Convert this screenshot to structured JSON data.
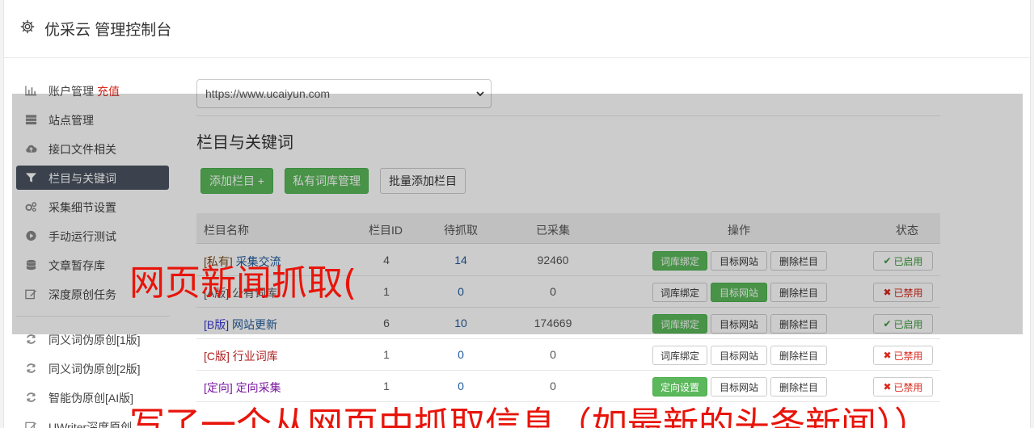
{
  "header": {
    "title": "优采云 管理控制台",
    "icon": "gear-icon"
  },
  "sidebar": {
    "items": [
      {
        "label": "账户管理",
        "extra": "充值",
        "icon": "bar-chart-icon"
      },
      {
        "label": "站点管理",
        "icon": "server-icon"
      },
      {
        "label": "接口文件相关",
        "icon": "cloud-upload-icon"
      },
      {
        "label": "栏目与关键词",
        "icon": "filter-icon",
        "active": true
      },
      {
        "label": "采集细节设置",
        "icon": "cogs-icon"
      },
      {
        "label": "手动运行测试",
        "icon": "play-circle-icon"
      },
      {
        "label": "文章暂存库",
        "icon": "database-icon"
      },
      {
        "label": "深度原创任务",
        "icon": "edit-icon"
      },
      {
        "label": "同义词伪原创[1版]",
        "icon": "refresh-icon"
      },
      {
        "label": "同义词伪原创[2版]",
        "icon": "refresh-icon"
      },
      {
        "label": "智能伪原创[AI版]",
        "icon": "refresh-icon"
      },
      {
        "label": "UWriter深度原创",
        "icon": "edit-icon"
      }
    ]
  },
  "site_select": {
    "value": "https://www.ucaiyun.com"
  },
  "section": {
    "title": "栏目与关键词"
  },
  "toolbar": {
    "add_column": "添加栏目 +",
    "private_lexicon": "私有词库管理",
    "batch_add": "批量添加栏目"
  },
  "table": {
    "headers": {
      "name": "栏目名称",
      "id": "栏目ID",
      "pending": "待抓取",
      "collected": "已采集",
      "ops": "操作",
      "status": "状态"
    },
    "rows": [
      {
        "tag": "[私有]",
        "name": "采集交流",
        "id": "4",
        "pending": "14",
        "collected": "92460",
        "op1": "词库绑定",
        "op2": "目标网站",
        "op3": "删除栏目",
        "status": "已启用"
      },
      {
        "tag": "[A版]",
        "name": "公有词库",
        "id": "1",
        "pending": "0",
        "collected": "0",
        "op1": "词库绑定",
        "op2": "目标网站",
        "op3": "删除栏目",
        "status": "已禁用"
      },
      {
        "tag": "[B版]",
        "name": "网站更新",
        "id": "6",
        "pending": "10",
        "collected": "174669",
        "op1": "词库绑定",
        "op2": "目标网站",
        "op3": "删除栏目",
        "status": "已启用"
      },
      {
        "tag": "[C版]",
        "name": "行业词库",
        "id": "1",
        "pending": "0",
        "collected": "0",
        "op1": "词库绑定",
        "op2": "目标网站",
        "op3": "删除栏目",
        "status": "已禁用"
      },
      {
        "tag": "[定向]",
        "name": "定向采集",
        "id": "1",
        "pending": "0",
        "collected": "0",
        "op1": "定向设置",
        "op2": "目标网站",
        "op3": "删除栏目",
        "status": "已禁用"
      }
    ]
  },
  "overlay": {
    "text1": "网页新闻抓取(",
    "text2": "写了一个从网页中抓取信息（如最新的头条新闻））"
  },
  "colors": {
    "green": "#5cb85c",
    "active_nav": "#4a5361",
    "red": "#d9291c",
    "overlay_text": "#e8140a"
  }
}
